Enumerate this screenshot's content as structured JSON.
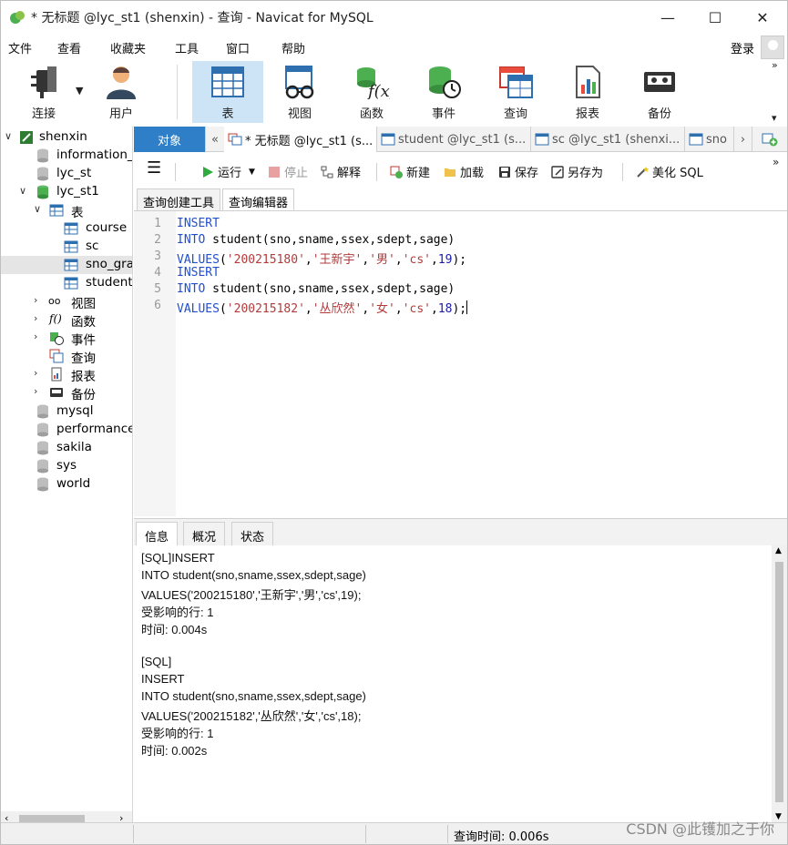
{
  "window": {
    "title": "* 无标题 @lyc_st1 (shenxin) - 查询 - Navicat for MySQL",
    "minimize": "—",
    "maximize": "☐",
    "close": "✕"
  },
  "menu": {
    "items": [
      "文件",
      "查看",
      "收藏夹",
      "工具",
      "窗口",
      "帮助"
    ],
    "login": "登录"
  },
  "toolbar": {
    "items": [
      {
        "label": "连接",
        "icon": "plug-icon"
      },
      {
        "label": "用户",
        "icon": "user-icon"
      },
      {
        "label": "表",
        "icon": "table-icon"
      },
      {
        "label": "视图",
        "icon": "view-icon"
      },
      {
        "label": "函数",
        "icon": "function-icon"
      },
      {
        "label": "事件",
        "icon": "event-icon"
      },
      {
        "label": "查询",
        "icon": "query-icon"
      },
      {
        "label": "报表",
        "icon": "report-icon"
      },
      {
        "label": "备份",
        "icon": "backup-icon"
      }
    ],
    "active": "表"
  },
  "sidebar": {
    "connection": "shenxin",
    "databases_top": [
      "information_",
      "lyc_st",
      "lyc_st1"
    ],
    "table_group": "表",
    "tables": [
      "course",
      "sc",
      "sno_gra",
      "student"
    ],
    "selected_table": "sno_gra",
    "groups": [
      "视图",
      "函数",
      "事件",
      "查询",
      "报表",
      "备份"
    ],
    "databases_bottom": [
      "mysql",
      "performance",
      "sakila",
      "sys",
      "world"
    ]
  },
  "tabs": {
    "objects": "对象",
    "items": [
      "* 无标题 @lyc_st1 (s...",
      "student @lyc_st1 (s...",
      "sc @lyc_st1 (shenxi...",
      "sno"
    ]
  },
  "query_toolbar": {
    "run": "运行",
    "stop": "停止",
    "explain": "解释",
    "new": "新建",
    "load": "加载",
    "save": "保存",
    "save_as": "另存为",
    "beautify": "美化 SQL"
  },
  "editor_tabs": [
    "查询创建工具",
    "查询编辑器"
  ],
  "editor": {
    "lines": [
      {
        "n": "1",
        "parts": [
          {
            "t": "INSERT",
            "c": "kw"
          }
        ]
      },
      {
        "n": "2",
        "parts": [
          {
            "t": "INTO",
            "c": "kw"
          },
          {
            "t": " student(sno,sname,ssex,sdept,sage)",
            "c": ""
          }
        ]
      },
      {
        "n": "3",
        "parts": [
          {
            "t": "VALUES",
            "c": "kw"
          },
          {
            "t": "(",
            "c": ""
          },
          {
            "t": "'200215180'",
            "c": "str"
          },
          {
            "t": ",",
            "c": ""
          },
          {
            "t": "'王新宇'",
            "c": "str"
          },
          {
            "t": ",",
            "c": ""
          },
          {
            "t": "'男'",
            "c": "str"
          },
          {
            "t": ",",
            "c": ""
          },
          {
            "t": "'cs'",
            "c": "str"
          },
          {
            "t": ",",
            "c": ""
          },
          {
            "t": "19",
            "c": "num"
          },
          {
            "t": ");",
            "c": ""
          }
        ]
      },
      {
        "n": "4",
        "parts": [
          {
            "t": "INSERT",
            "c": "kw"
          }
        ]
      },
      {
        "n": "5",
        "parts": [
          {
            "t": "INTO",
            "c": "kw"
          },
          {
            "t": " student(sno,sname,ssex,sdept,sage)",
            "c": ""
          }
        ]
      },
      {
        "n": "6",
        "parts": [
          {
            "t": "VALUES",
            "c": "kw"
          },
          {
            "t": "(",
            "c": ""
          },
          {
            "t": "'200215182'",
            "c": "str"
          },
          {
            "t": ",",
            "c": ""
          },
          {
            "t": "'丛欣然'",
            "c": "str"
          },
          {
            "t": ",",
            "c": ""
          },
          {
            "t": "'女'",
            "c": "str"
          },
          {
            "t": ",",
            "c": ""
          },
          {
            "t": "'cs'",
            "c": "str"
          },
          {
            "t": ",",
            "c": ""
          },
          {
            "t": "18",
            "c": "num"
          },
          {
            "t": ");",
            "c": ""
          }
        ]
      }
    ]
  },
  "result_tabs": [
    "信息",
    "概况",
    "状态"
  ],
  "messages": [
    "[SQL]INSERT",
    "INTO student(sno,sname,ssex,sdept,sage)",
    "VALUES('200215180','王新宇','男','cs',19);",
    "受影响的行: 1",
    "时间: 0.004s",
    "",
    "[SQL]",
    "INSERT",
    "INTO student(sno,sname,ssex,sdept,sage)",
    "VALUES('200215182','丛欣然','女','cs',18);",
    "受影响的行: 1",
    "时间: 0.002s"
  ],
  "status": {
    "query_time": "查询时间: 0.006s"
  },
  "watermark": "CSDN @此镬加之于你",
  "colors": {
    "accent": "#2e7fc7",
    "toolbar_active": "#cde4f7",
    "keyword": "#1f4fcf",
    "string": "#b33a3a"
  }
}
